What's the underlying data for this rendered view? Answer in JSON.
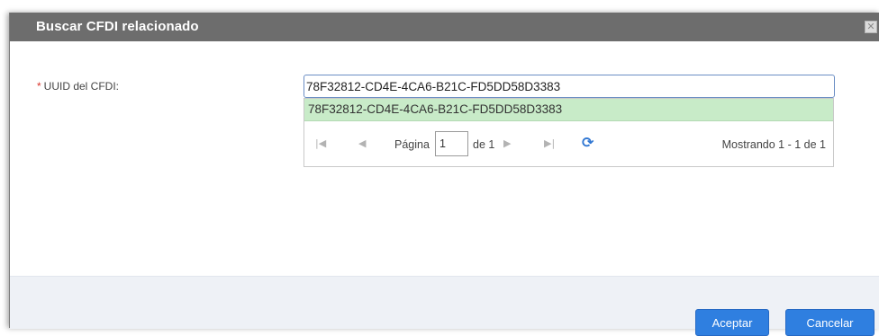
{
  "dialog": {
    "title": "Buscar CFDI relacionado",
    "close_icon": "close-icon"
  },
  "form": {
    "required_marker": "*",
    "uuid_label": "UUID del CFDI:",
    "uuid_value": "78F32812-CD4E-4CA6-B21C-FD5DD58D3383"
  },
  "suggestions": {
    "items": [
      "78F32812-CD4E-4CA6-B21C-FD5DD58D3383"
    ],
    "highlight_color": "#c8ebc8"
  },
  "pager": {
    "first_icon": "first-page-icon",
    "prev_icon": "prev-page-icon",
    "next_icon": "next-page-icon",
    "last_icon": "last-page-icon",
    "refresh_icon": "refresh-icon",
    "page_label": "Página",
    "page_value": "1",
    "of_label": "de 1",
    "status": "Mostrando 1 - 1 de 1"
  },
  "footer": {
    "accept_label": "Aceptar",
    "cancel_label": "Cancelar",
    "button_color": "#2f7fe0"
  }
}
